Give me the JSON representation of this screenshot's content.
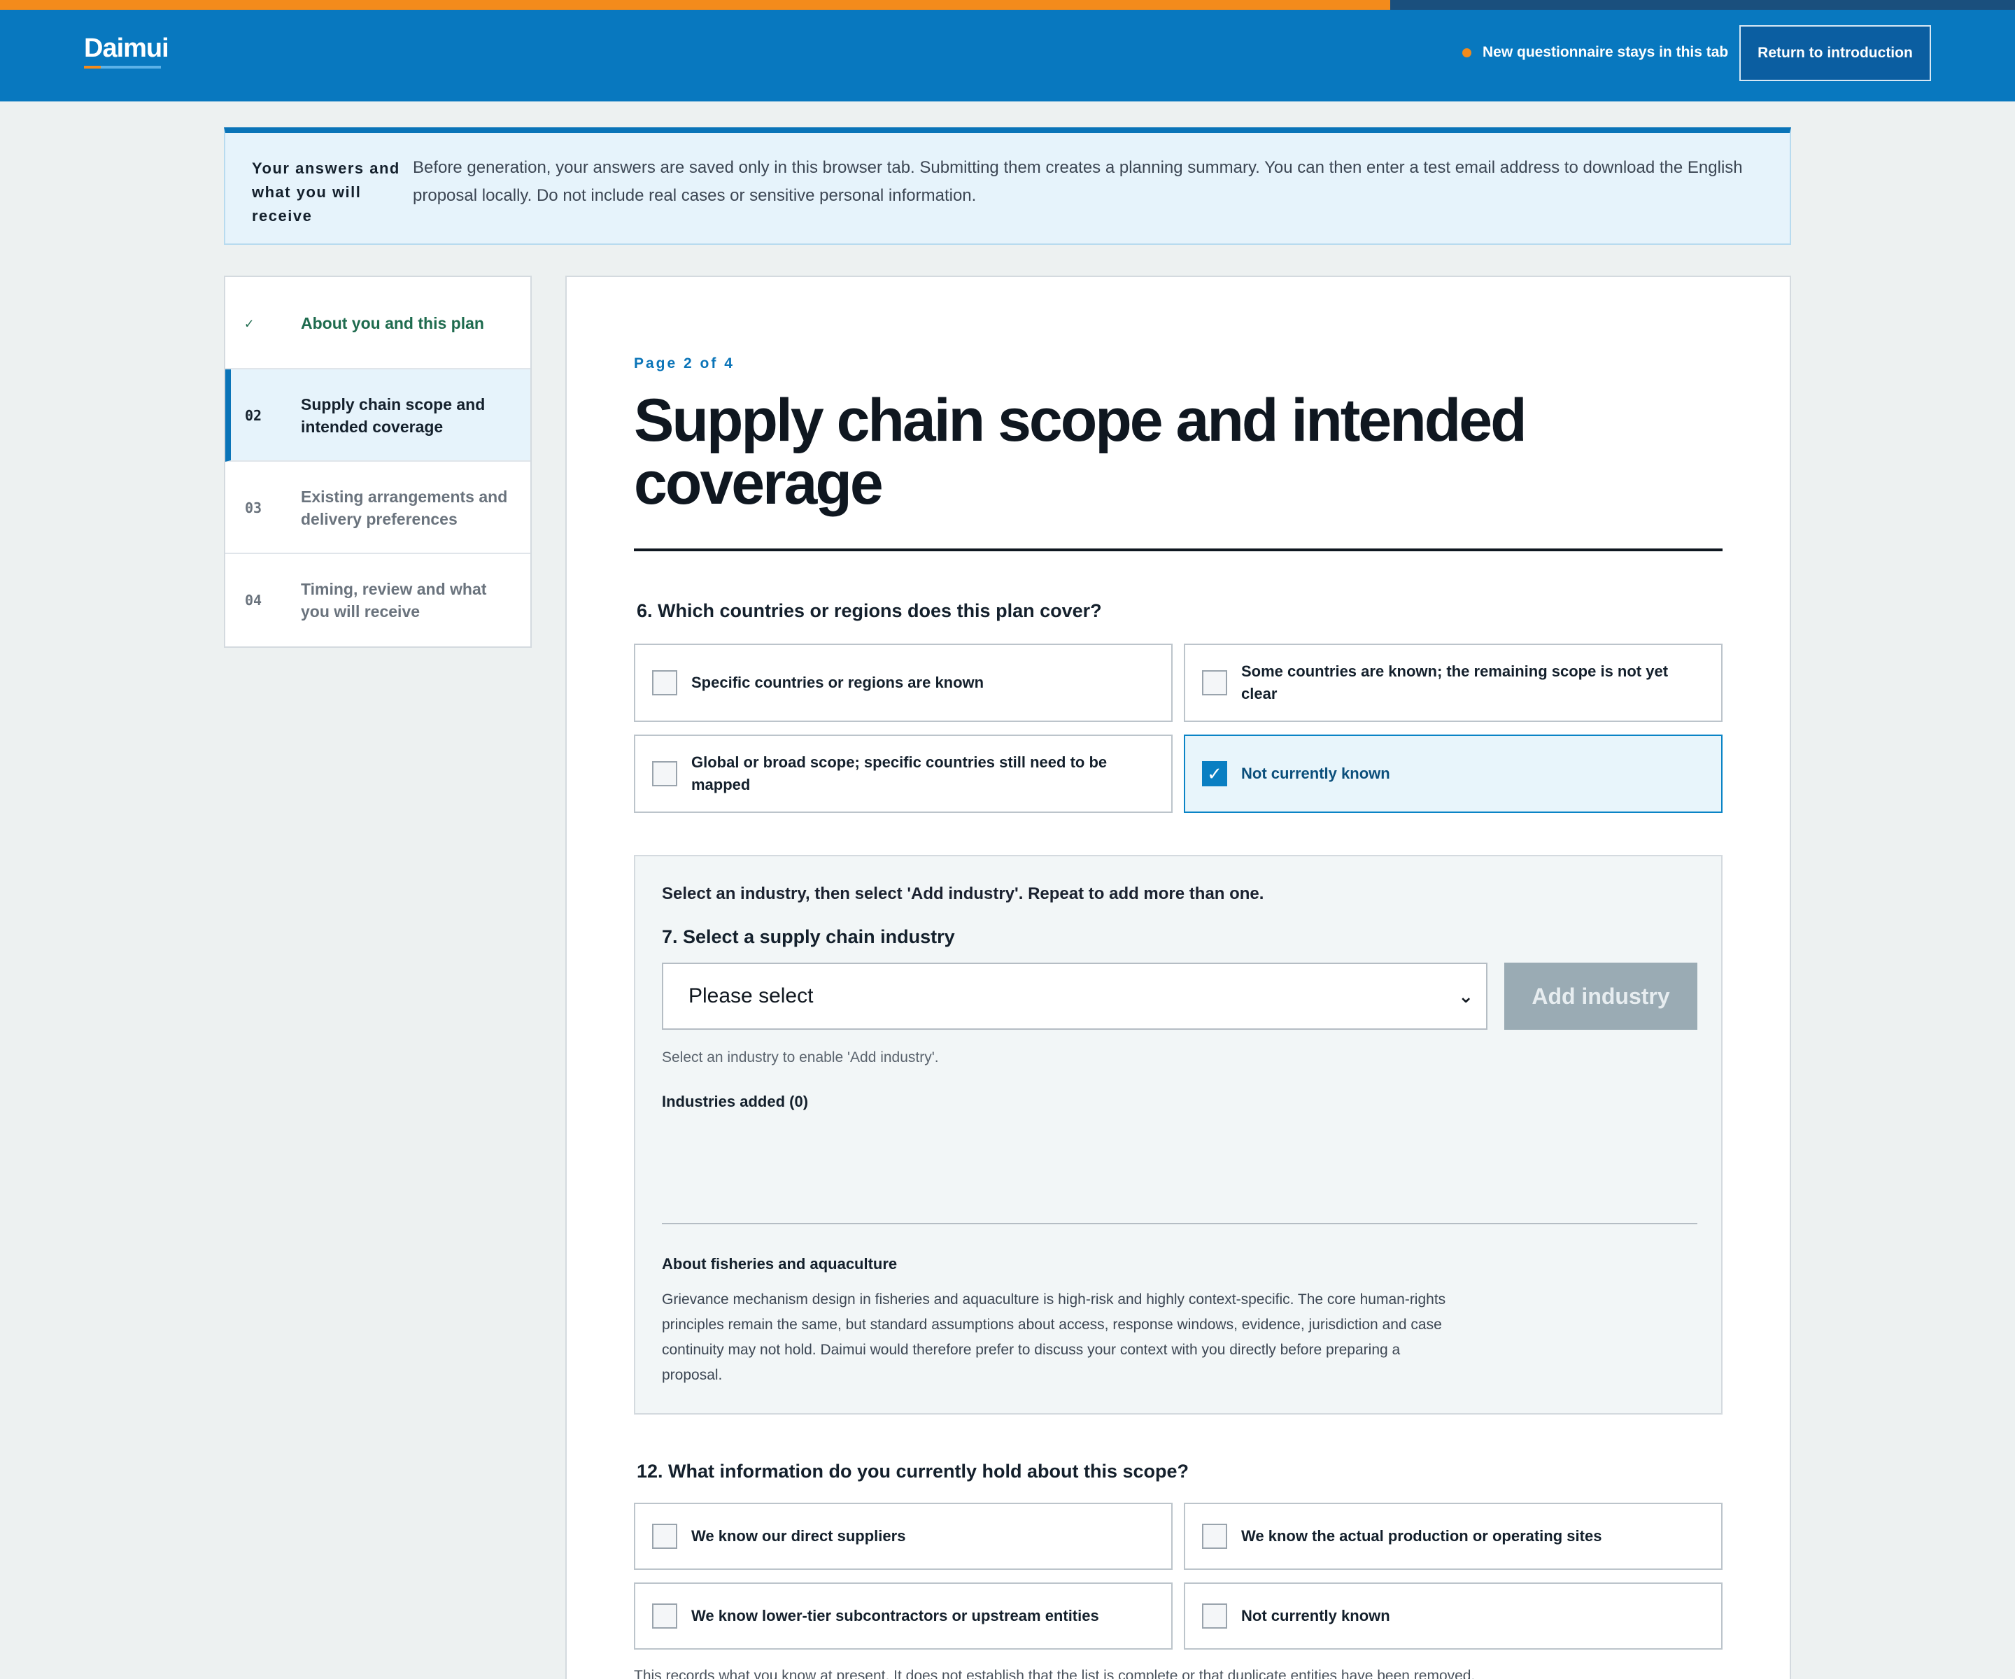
{
  "header": {
    "logo_text": "Daimui",
    "status_text": "New questionnaire stays in this tab",
    "return_button_label": "Return to introduction",
    "progress_fraction": 0.69,
    "colors": {
      "brand_blue": "#0878bf",
      "accent_orange": "#f38b1c"
    }
  },
  "banner": {
    "title": "Your answers and what you will receive",
    "text": "Before generation, your answers are saved only in this browser tab. Submitting them creates a planning summary. You can then enter a test email address to download the English proposal locally. Do not include real cases or sensitive personal information."
  },
  "sidenav": {
    "items": [
      {
        "num": "✓",
        "label": "About you and this plan",
        "state": "done"
      },
      {
        "num": "02",
        "label": "Supply chain scope and intended coverage",
        "state": "active"
      },
      {
        "num": "03",
        "label": "Existing arrangements and delivery preferences",
        "state": "upcoming"
      },
      {
        "num": "04",
        "label": "Timing, review and what you will receive",
        "state": "upcoming"
      }
    ]
  },
  "main": {
    "kicker": "Page 2 of 4",
    "title": "Supply chain scope and intended coverage",
    "q6": {
      "label": "6. Which countries or regions does this plan cover?",
      "options": [
        {
          "label": "Specific countries or regions are known",
          "checked": false
        },
        {
          "label": "Some countries are known; the remaining scope is not yet clear",
          "checked": false
        },
        {
          "label": "Global or broad scope; specific countries still need to be mapped",
          "checked": false
        },
        {
          "label": "Not currently known",
          "checked": true
        }
      ]
    },
    "industry": {
      "instruction": "Select an industry, then select 'Add industry'. Repeat to add more than one.",
      "question": "7. Select a supply chain industry",
      "select_value": "Please select",
      "add_button_label": "Add industry",
      "hint": "Select an industry to enable 'Add industry'.",
      "added_label": "Industries added (0)",
      "fisheries_title": "About fisheries and aquaculture",
      "fisheries_body": "Grievance mechanism design in fisheries and aquaculture is high-risk and highly context-specific. The core human-rights principles remain the same, but standard assumptions about access, response windows, evidence, jurisdiction and case continuity may not hold. Daimui would therefore prefer to discuss your context with you directly before preparing a proposal."
    },
    "q12": {
      "label": "12. What information do you currently hold about this scope?",
      "options": [
        {
          "label": "We know our direct suppliers",
          "checked": false
        },
        {
          "label": "We know the actual production or operating sites",
          "checked": false
        },
        {
          "label": "We know lower-tier subcontractors or upstream entities",
          "checked": false
        },
        {
          "label": "Not currently known",
          "checked": false
        }
      ]
    },
    "footnote": "This records what you know at present. It does not establish that the list is complete or that duplicate entities have been removed."
  }
}
